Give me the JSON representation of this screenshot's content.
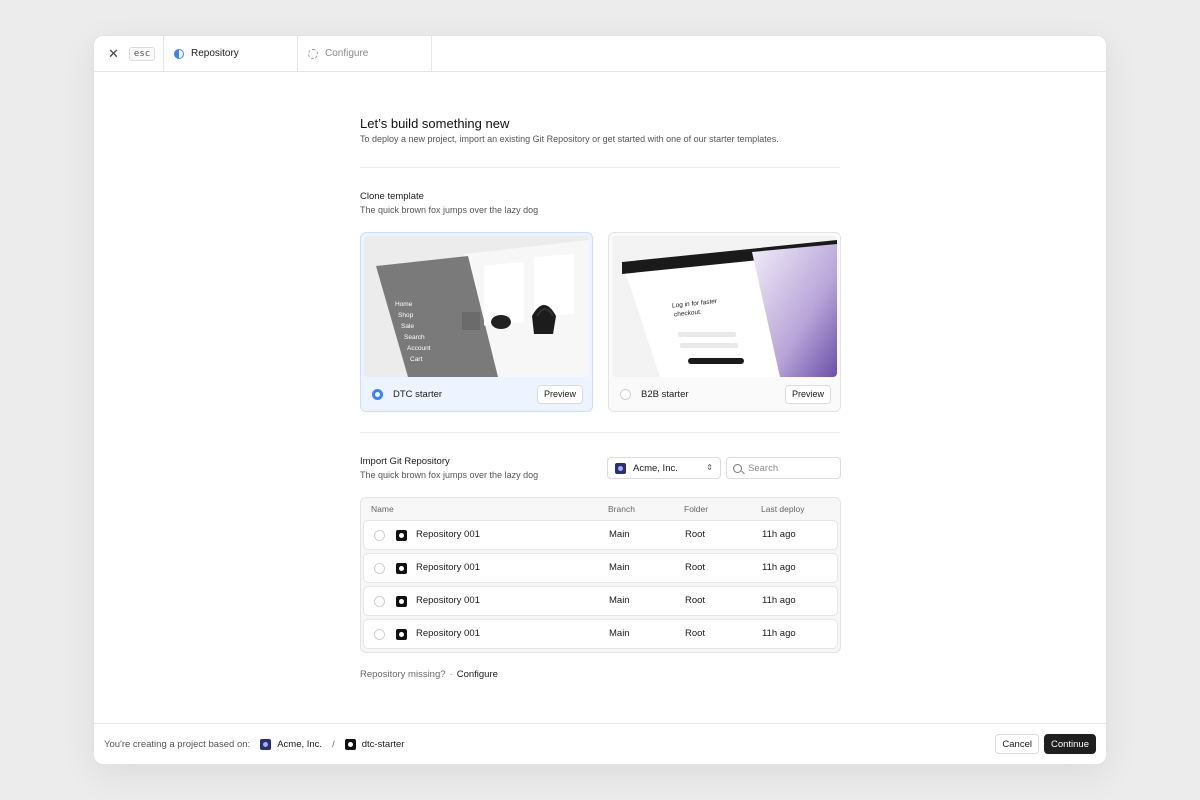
{
  "steps": {
    "esc_label": "esc",
    "items": [
      {
        "label": "Repository",
        "state": "active"
      },
      {
        "label": "Configure",
        "state": "pending"
      }
    ]
  },
  "intro": {
    "title": "Let’s build something new",
    "subtitle": "To deploy a new project, import an existing Git Repository or get started with one of our starter templates."
  },
  "clone": {
    "title": "Clone template",
    "subtitle": "The quick brown fox jumps over the lazy dog",
    "templates": [
      {
        "name": "DTC starter",
        "selected": true,
        "preview_label": "Preview",
        "menu": [
          "Home",
          "Shop",
          "Sale",
          "Search",
          "Account",
          "Cart"
        ]
      },
      {
        "name": "B2B starter",
        "selected": false,
        "preview_label": "Preview",
        "heading": "Log in for faster checkout."
      }
    ]
  },
  "import": {
    "title": "Import Git Repository",
    "subtitle": "The quick brown fox jumps over the lazy dog",
    "account": "Acme, Inc.",
    "search_placeholder": "Search",
    "columns": [
      "Name",
      "Branch",
      "Folder",
      "Last deploy"
    ],
    "rows": [
      {
        "name": "Repository 001",
        "branch": "Main",
        "folder": "Root",
        "last_deploy": "11h ago"
      },
      {
        "name": "Repository 001",
        "branch": "Main",
        "folder": "Root",
        "last_deploy": "11h ago"
      },
      {
        "name": "Repository 001",
        "branch": "Main",
        "folder": "Root",
        "last_deploy": "11h ago"
      },
      {
        "name": "Repository 001",
        "branch": "Main",
        "folder": "Root",
        "last_deploy": "11h ago"
      }
    ],
    "missing_text": "Repository missing?",
    "separator": "·",
    "configure_link": "Configure"
  },
  "footer": {
    "text": "You're creating a project based on:",
    "org": "Acme, Inc.",
    "separator": "/",
    "template": "dtc-starter",
    "cancel_label": "Cancel",
    "continue_label": "Continue"
  },
  "colors": {
    "accent": "#3b82f6",
    "selected_card_bg": "#eef4ff",
    "primary_button": "#1f1f1f"
  }
}
